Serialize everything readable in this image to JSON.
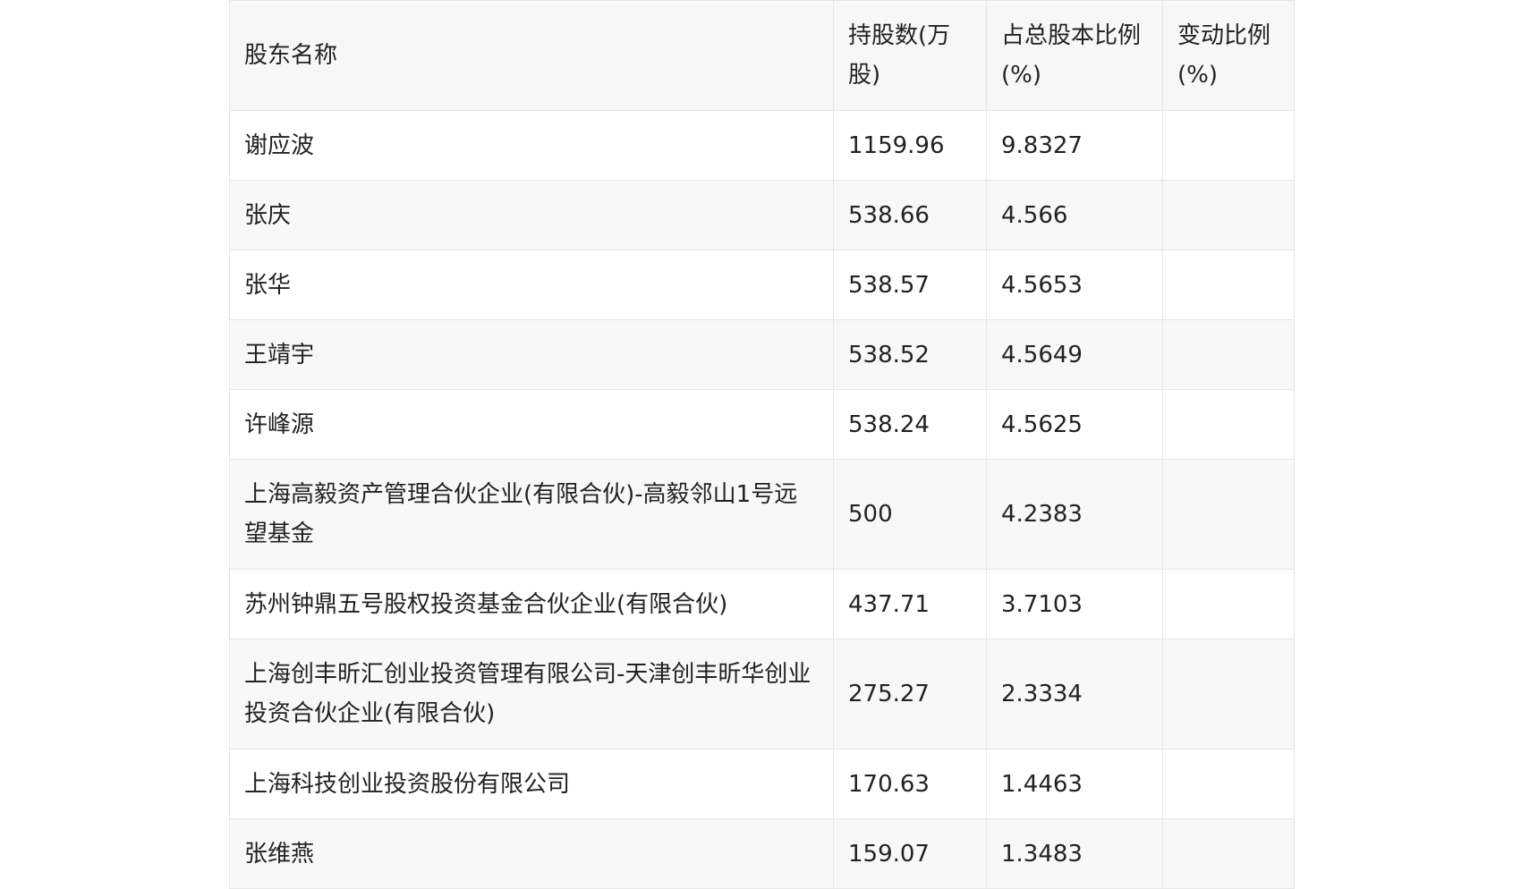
{
  "table": {
    "headers": [
      "股东名称",
      "持股数(万股)",
      "占总股本比例(%)",
      "变动比例(%)"
    ],
    "rows": [
      {
        "name": "谢应波",
        "shares": "1159.96",
        "ratio": "9.8327",
        "change": ""
      },
      {
        "name": "张庆",
        "shares": "538.66",
        "ratio": "4.566",
        "change": ""
      },
      {
        "name": "张华",
        "shares": "538.57",
        "ratio": "4.5653",
        "change": ""
      },
      {
        "name": "王靖宇",
        "shares": "538.52",
        "ratio": "4.5649",
        "change": ""
      },
      {
        "name": "许峰源",
        "shares": "538.24",
        "ratio": "4.5625",
        "change": ""
      },
      {
        "name": "上海高毅资产管理合伙企业(有限合伙)-高毅邻山1号远望基金",
        "shares": "500",
        "ratio": "4.2383",
        "change": ""
      },
      {
        "name": "苏州钟鼎五号股权投资基金合伙企业(有限合伙)",
        "shares": "437.71",
        "ratio": "3.7103",
        "change": ""
      },
      {
        "name": "上海创丰昕汇创业投资管理有限公司-天津创丰昕华创业投资合伙企业(有限合伙)",
        "shares": "275.27",
        "ratio": "2.3334",
        "change": ""
      },
      {
        "name": "上海科技创业投资股份有限公司",
        "shares": "170.63",
        "ratio": "1.4463",
        "change": ""
      },
      {
        "name": "张维燕",
        "shares": "159.07",
        "ratio": "1.3483",
        "change": ""
      }
    ]
  }
}
